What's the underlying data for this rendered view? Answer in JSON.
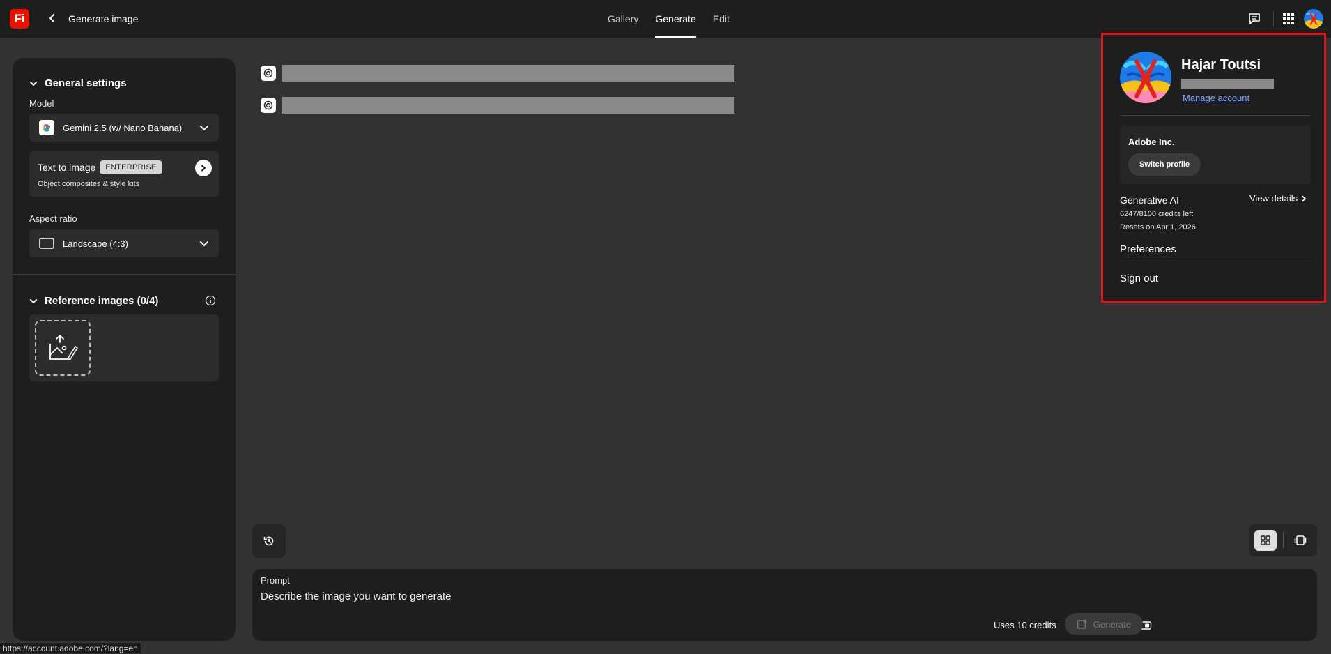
{
  "app": {
    "logo_text": "Fi",
    "page_title": "Generate image",
    "brand_color": "#eb1000"
  },
  "nav": {
    "tabs": [
      {
        "label": "Gallery",
        "active": false
      },
      {
        "label": "Generate",
        "active": true
      },
      {
        "label": "Edit",
        "active": false
      }
    ]
  },
  "topbar_icons": [
    "feedback-icon",
    "apps-grid-icon",
    "user-avatar"
  ],
  "settings": {
    "general_title": "General settings",
    "model_label": "Model",
    "model_value": "Gemini 2.5 (w/ Nano Banana)",
    "t2i_title": "Text to image",
    "t2i_badge": "ENTERPRISE",
    "t2i_subtitle": "Object composites & style kits",
    "aspect_label": "Aspect ratio",
    "aspect_value": "Landscape (4:3)",
    "reference_title": "Reference images (0/4)"
  },
  "prompt": {
    "label": "Prompt",
    "placeholder": "Describe the image you want to generate",
    "credits_text": "Uses 10 credits",
    "generate_label": "Generate"
  },
  "account": {
    "name": "Hajar Toutsi",
    "manage_label": "Manage account",
    "org_name": "Adobe Inc.",
    "switch_label": "Switch profile",
    "gen_ai_title": "Generative AI",
    "credits_left": "6247/8100 credits left",
    "resets": "Resets on Apr 1, 2026",
    "view_details": "View details",
    "preferences": "Preferences",
    "sign_out": "Sign out",
    "highlight_color": "#d7191c",
    "link_color": "#80a8ff"
  },
  "status_bar": {
    "url": "https://account.adobe.com/?lang=en"
  }
}
